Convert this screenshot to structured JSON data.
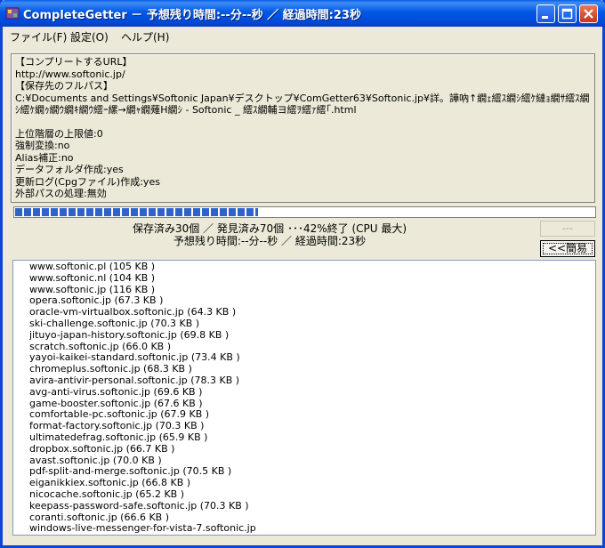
{
  "window": {
    "title": "CompleteGetter － 予想残り時間:--分--秒 ／ 経過時間:23秒"
  },
  "menu": [
    {
      "label": "ファイル(F)"
    },
    {
      "label": "設定(O)"
    },
    {
      "label": "ヘルプ(H)"
    }
  ],
  "info": {
    "url_header": "【コンプリートするURL】",
    "url": "http://www.softonic.jp/",
    "path_header": "【保存先のフルパス】",
    "path": "C:¥Documents and Settings¥Softonic Japan¥デスクトップ¥ComGetter63¥Softonic.jp¥詳。譁吶↑繝ｪ繧ｽ繝ｼ繧ｹ縺ｮ繝ｻ繧ｽ繝ｼ繧ｹ繝ｩ繝ｳ繝ｷ繝ｳ繧ｰ縲→繝ｬ繝薙Η繝ｼ - Softonic _ 繧ｽ繝輔ヨ繧ｦ繧ｧ繧｢.html",
    "lines": [
      "上位階層の上限値:0",
      "強制変換:no",
      "Alias補正:no",
      "データフォルダ作成:yes",
      "更新ログ(Cpgファイル)作成:yes",
      "外部パスの処理:無効"
    ]
  },
  "progress": {
    "fraction": 0.42
  },
  "status": {
    "line1": "保存済み30個 ／ 発見済み70個 ･･･42%終了 (CPU 最大)",
    "line2": "予想残り時間:--分--秒 ／ 経過時間:23秒"
  },
  "buttons": {
    "disabled_label": "---",
    "simple_label": "<<簡易"
  },
  "files": [
    "www.softonic.pl  (105 KB )",
    "www.softonic.nl  (104 KB )",
    "www.softonic.jp  (116 KB )",
    "opera.softonic.jp  (67.3 KB )",
    "oracle-vm-virtualbox.softonic.jp  (64.3 KB )",
    "ski-challenge.softonic.jp  (70.3 KB )",
    "jituyo-japan-history.softonic.jp  (69.8 KB )",
    "scratch.softonic.jp  (66.0 KB )",
    "yayoi-kaikei-standard.softonic.jp  (73.4 KB )",
    "chromeplus.softonic.jp  (68.3 KB )",
    "avira-antivir-personal.softonic.jp  (78.3 KB )",
    "avg-anti-virus.softonic.jp  (69.6 KB )",
    "game-booster.softonic.jp  (67.6 KB )",
    "comfortable-pc.softonic.jp  (67.9 KB )",
    "format-factory.softonic.jp  (70.3 KB )",
    "ultimatedefrag.softonic.jp  (65.9 KB )",
    "dropbox.softonic.jp  (66.7 KB )",
    "avast.softonic.jp  (70.0 KB )",
    "pdf-split-and-merge.softonic.jp  (70.5 KB )",
    "eiganikkiex.softonic.jp  (66.8 KB )",
    "nicocache.softonic.jp  (65.2 KB )",
    "keepass-password-safe.softonic.jp  (70.3 KB )",
    "coranti.softonic.jp  (66.6 KB )",
    "windows-live-messenger-for-vista-7.softonic.jp"
  ]
}
